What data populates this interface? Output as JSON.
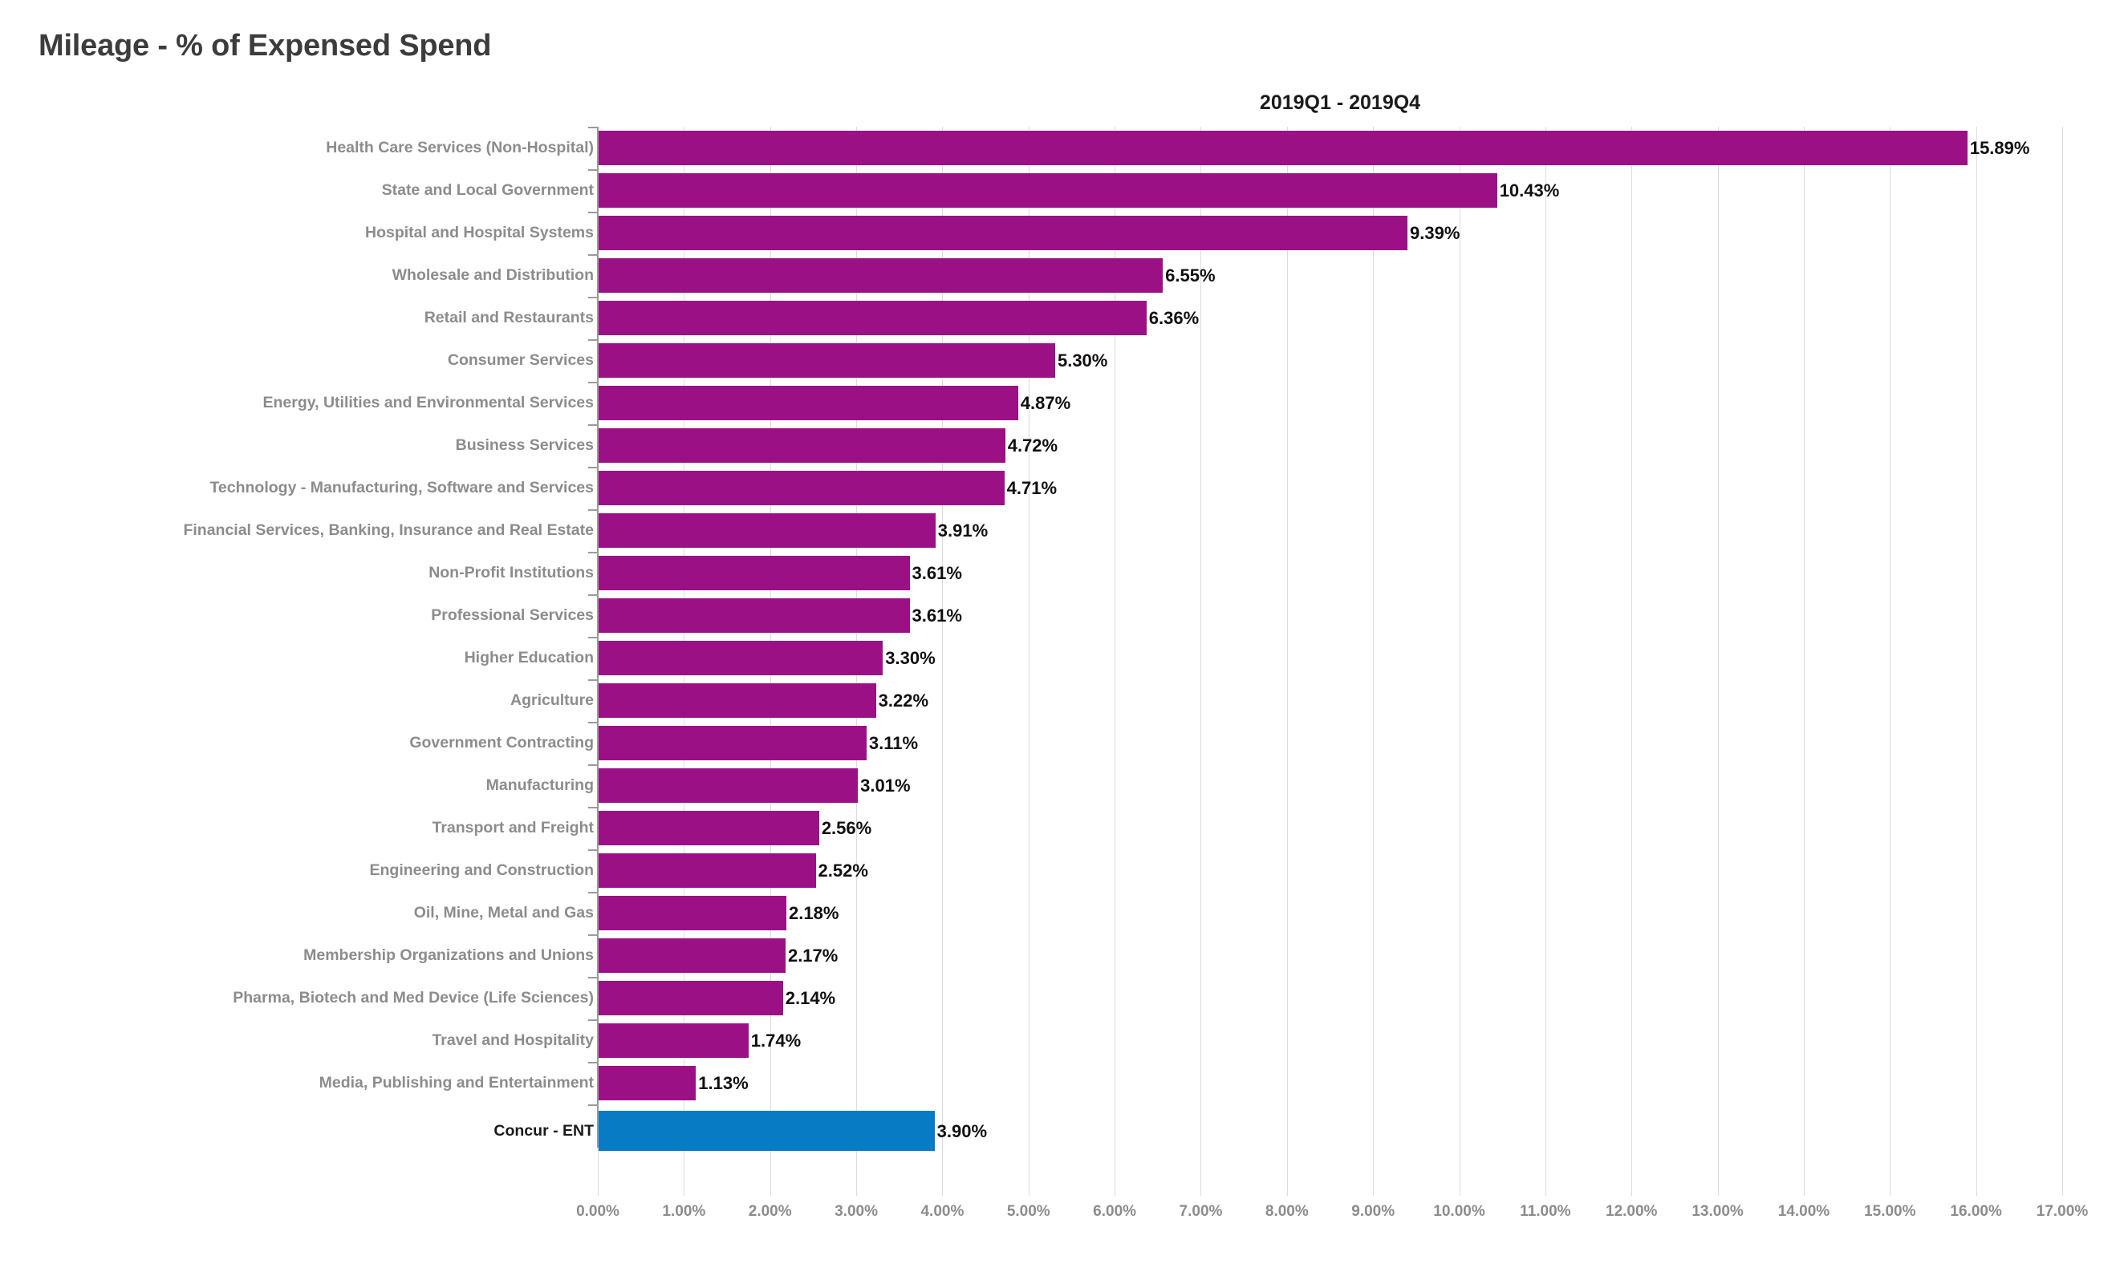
{
  "header": {
    "title": "Mileage - % of Expensed Spend"
  },
  "chart_data": {
    "type": "bar",
    "orientation": "horizontal",
    "title": "Mileage - % of Expensed Spend",
    "subtitle": "2019Q1 - 2019Q4",
    "xlabel": "",
    "ylabel": "",
    "xlim": [
      0,
      17
    ],
    "x_tick_labels": [
      "0.00%",
      "1.00%",
      "2.00%",
      "3.00%",
      "4.00%",
      "5.00%",
      "6.00%",
      "7.00%",
      "8.00%",
      "9.00%",
      "10.00%",
      "11.00%",
      "12.00%",
      "13.00%",
      "14.00%",
      "15.00%",
      "16.00%",
      "17.00%"
    ],
    "x_tick_values": [
      0,
      1,
      2,
      3,
      4,
      5,
      6,
      7,
      8,
      9,
      10,
      11,
      12,
      13,
      14,
      15,
      16,
      17
    ],
    "grid": true,
    "legend": "none",
    "value_suffix": "%",
    "colors": {
      "industry_bar": "#9b1185",
      "highlight_bar": "#077cc4",
      "gridline": "#dcdcdc",
      "label_text": "#8c8c8c",
      "highlight_label_text": "#1a1a1a",
      "value_text": "#101010",
      "title_text": "#3c3c3c",
      "background": "#ffffff"
    },
    "categories": [
      "Health Care Services (Non-Hospital)",
      "State and Local Government",
      "Hospital and Hospital Systems",
      "Wholesale and Distribution",
      "Retail and Restaurants",
      "Consumer Services",
      "Energy, Utilities and Environmental Services",
      "Business Services",
      "Technology - Manufacturing, Software and Services",
      "Financial Services, Banking, Insurance and Real Estate",
      "Non-Profit Institutions",
      "Professional Services",
      "Higher Education",
      "Agriculture",
      "Government Contracting",
      "Manufacturing",
      "Transport and Freight",
      "Engineering and Construction",
      "Oil, Mine, Metal and Gas",
      "Membership Organizations and Unions",
      "Pharma, Biotech and Med Device (Life Sciences)",
      "Travel and Hospitality",
      "Media, Publishing and Entertainment",
      "Concur - ENT"
    ],
    "values": [
      15.89,
      10.43,
      9.39,
      6.55,
      6.36,
      5.3,
      4.87,
      4.72,
      4.71,
      3.91,
      3.61,
      3.61,
      3.3,
      3.22,
      3.11,
      3.01,
      2.56,
      2.52,
      2.18,
      2.17,
      2.14,
      1.74,
      1.13,
      3.9
    ],
    "value_labels": [
      "15.89%",
      "10.43%",
      "9.39%",
      "6.55%",
      "6.36%",
      "5.30%",
      "4.87%",
      "4.72%",
      "4.71%",
      "3.91%",
      "3.61%",
      "3.61%",
      "3.30%",
      "3.22%",
      "3.11%",
      "3.01%",
      "2.56%",
      "2.52%",
      "2.18%",
      "2.17%",
      "2.14%",
      "1.74%",
      "1.13%",
      "3.90%"
    ],
    "highlight_index": 23,
    "highlight_category": "Concur - ENT"
  }
}
